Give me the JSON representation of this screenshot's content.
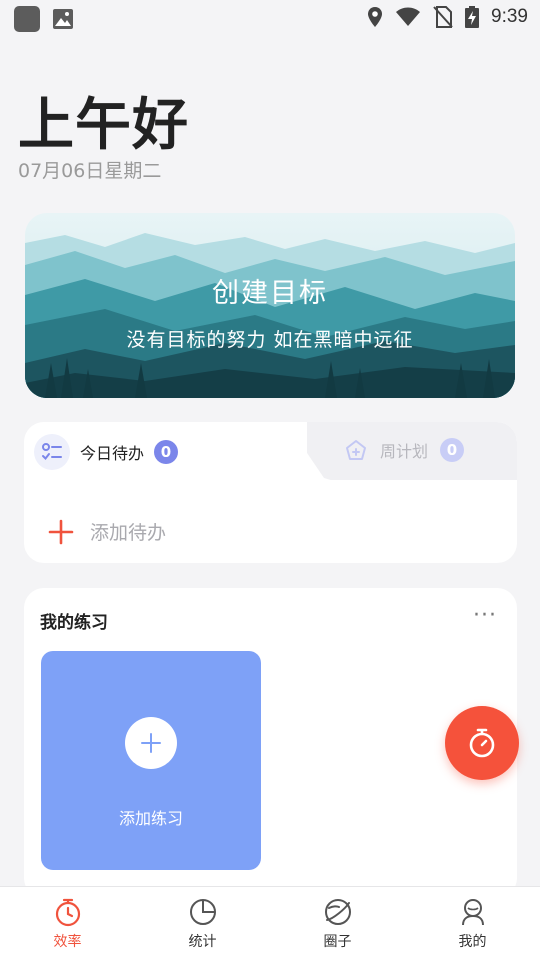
{
  "status_bar": {
    "time": "9:39"
  },
  "header": {
    "greeting": "上午好",
    "date": "07月06日星期二"
  },
  "banner": {
    "title": "创建目标",
    "subtitle": "没有目标的努力 如在黑暗中远征"
  },
  "todo": {
    "tabs": [
      {
        "label": "今日待办",
        "count": "0",
        "active": true
      },
      {
        "label": "周计划",
        "count": "0",
        "active": false
      }
    ],
    "add_label": "添加待办"
  },
  "practice": {
    "title": "我的练习",
    "more": "···",
    "add_label": "添加练习"
  },
  "bottom_nav": {
    "items": [
      {
        "label": "效率",
        "icon": "stopwatch-icon",
        "active": true
      },
      {
        "label": "统计",
        "icon": "pie-chart-icon",
        "active": false
      },
      {
        "label": "圈子",
        "icon": "planet-icon",
        "active": false
      },
      {
        "label": "我的",
        "icon": "profile-icon",
        "active": false
      }
    ]
  },
  "colors": {
    "accent": "#f5523b",
    "tile": "#7ea1f7",
    "badge": "#7b86ea"
  }
}
